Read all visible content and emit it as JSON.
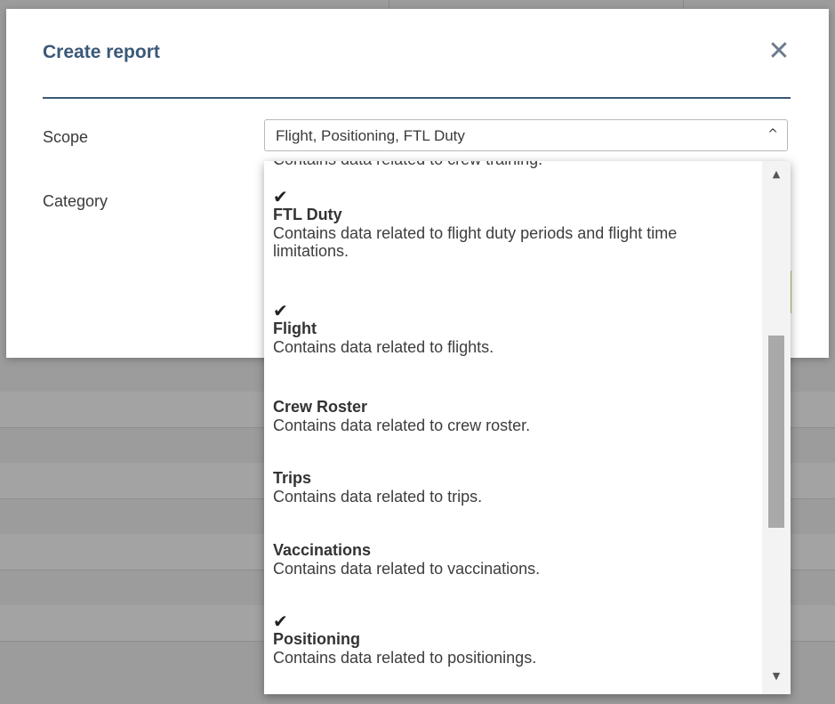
{
  "modal": {
    "title": "Create report",
    "close_glyph": "✕"
  },
  "form": {
    "scope_label": "Scope",
    "scope_value": "Flight, Positioning, FTL Duty",
    "category_label": "Category"
  },
  "dropdown": {
    "options": [
      {
        "title": "FTL Duty",
        "description": "Contains data related to flight duty periods and flight time limitations.",
        "checked": true
      },
      {
        "title": "Flight",
        "description": "Contains data related to flights.",
        "checked": true
      },
      {
        "title": "Crew Roster",
        "description": "Contains data related to crew roster.",
        "checked": false
      },
      {
        "title": "Trips",
        "description": "Contains data related to trips.",
        "checked": false
      },
      {
        "title": "Vaccinations",
        "description": "Contains data related to vaccinations.",
        "checked": false
      },
      {
        "title": "Positioning",
        "description": "Contains data related to positionings.",
        "checked": true
      }
    ]
  },
  "icons": {
    "check": "✔",
    "caret_up": "^",
    "scroll_up": "▲",
    "scroll_down": "▼"
  },
  "colors": {
    "title": "#3b5878",
    "overlay": "#9c9c9c",
    "accent_green": "#a8c46a"
  }
}
